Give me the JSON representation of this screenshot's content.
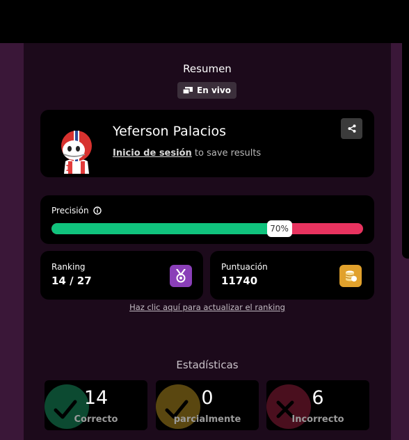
{
  "summary": {
    "title": "Resumen",
    "live_badge": "En vivo",
    "player_name": "Yeferson Palacios",
    "login_link": "Inicio de sesión",
    "login_suffix": "to save results"
  },
  "precision": {
    "label": "Precisión",
    "percent_text": "70%",
    "percent": 70,
    "correct_color": "#10c37d",
    "wrong_color": "#e8335f"
  },
  "ranking": {
    "label": "Ranking",
    "value": "14 / 27"
  },
  "score": {
    "label": "Puntuación",
    "value": "11740"
  },
  "refresh_link": "Haz clic aquí para actualizar el ranking",
  "stats": {
    "title": "Estadísticas",
    "tiles": [
      {
        "number": "14",
        "label": "Correcto",
        "color": "#0c4a31",
        "icon": "check-icon"
      },
      {
        "number": "0",
        "label": "parcialmente",
        "color": "#5a4710",
        "icon": "check-icon"
      },
      {
        "number": "6",
        "label": "Incorrecto",
        "color": "#4a0f1e",
        "icon": "cross-icon"
      }
    ]
  }
}
